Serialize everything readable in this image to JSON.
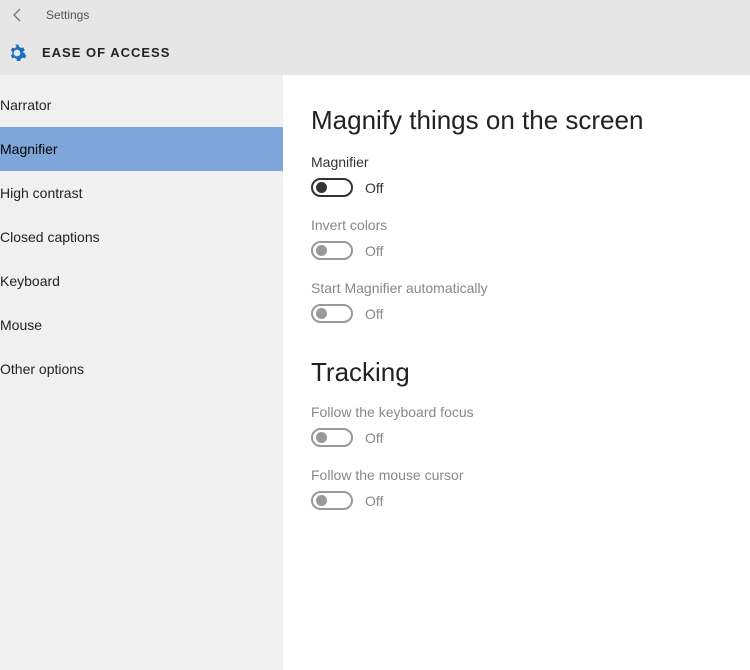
{
  "titlebar": {
    "app_title": "Settings"
  },
  "header": {
    "section_title": "EASE OF ACCESS"
  },
  "sidebar": {
    "items": [
      {
        "label": "Narrator"
      },
      {
        "label": "Magnifier"
      },
      {
        "label": "High contrast"
      },
      {
        "label": "Closed captions"
      },
      {
        "label": "Keyboard"
      },
      {
        "label": "Mouse"
      },
      {
        "label": "Other options"
      }
    ],
    "selected_index": 1
  },
  "content": {
    "heading_magnify": "Magnify things on the screen",
    "magnifier": {
      "label": "Magnifier",
      "state": "Off"
    },
    "invert_colors": {
      "label": "Invert colors",
      "state": "Off"
    },
    "start_auto": {
      "label": "Start Magnifier automatically",
      "state": "Off"
    },
    "heading_tracking": "Tracking",
    "follow_keyboard": {
      "label": "Follow the keyboard focus",
      "state": "Off"
    },
    "follow_mouse": {
      "label": "Follow the mouse cursor",
      "state": "Off"
    }
  }
}
